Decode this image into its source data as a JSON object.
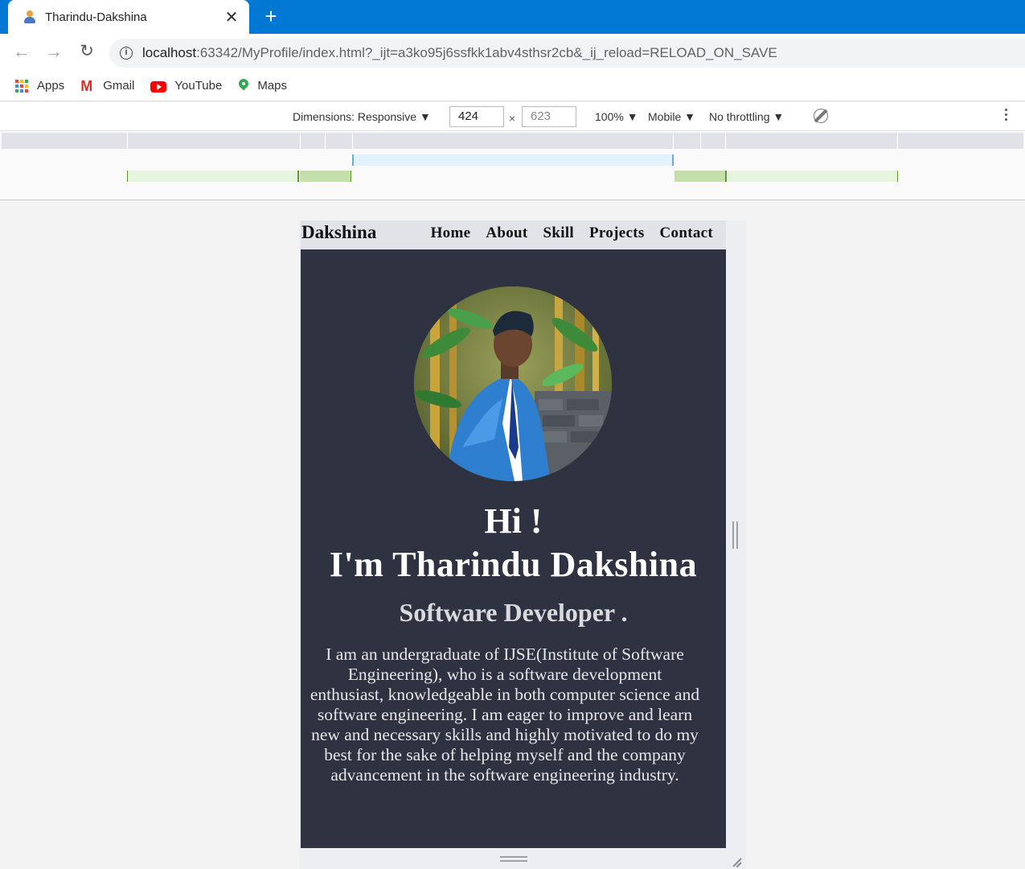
{
  "browser": {
    "tab_title": "Tharindu-Dakshina",
    "tab_close": "✕",
    "new_tab": "+",
    "url_host": "localhost",
    "url_rest": ":63342/MyProfile/index.html?_ijt=a3ko95j6ssfkk1abv4sthsr2cb&_ij_reload=RELOAD_ON_SAVE",
    "bookmarks": [
      {
        "label": "Apps",
        "icon": "apps-grid-icon"
      },
      {
        "label": "Gmail",
        "icon": "gmail-icon"
      },
      {
        "label": "YouTube",
        "icon": "youtube-icon"
      },
      {
        "label": "Maps",
        "icon": "maps-icon"
      }
    ]
  },
  "devtools": {
    "dimensions_label": "Dimensions: Responsive ▼",
    "width": "424",
    "height": "623",
    "times": "×",
    "zoom": "100% ▼",
    "device_type": "Mobile ▼",
    "throttling": "No throttling ▼"
  },
  "page": {
    "brand": "Dakshina",
    "nav": [
      "Home",
      "About",
      "Skill",
      "Projects",
      "Contact"
    ],
    "greeting": "Hi !",
    "name": "I'm Tharindu Dakshina",
    "role": "Software Developer .",
    "bio_lines": [
      "I am an undergraduate of IJSE(Institute of Software",
      "Engineering), who is a software development",
      "enthusiast, knowledgeable in both computer science and",
      "software engineering. I am eager to improve and learn",
      "new and necessary skills and highly motivated to do my",
      "best for the sake of helping myself and the company",
      "advancement in the software engineering industry."
    ]
  },
  "colors": {
    "tabstrip": "#0078d4",
    "page_bg": "#2f3341",
    "nav_bg": "#e1e3e8"
  }
}
